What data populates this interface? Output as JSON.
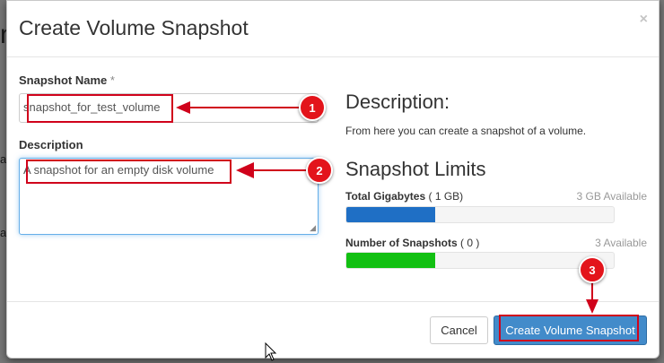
{
  "dialog": {
    "title": "Create Volume Snapshot",
    "close_glyph": "×"
  },
  "form": {
    "snapshot_name_label": "Snapshot Name",
    "required_mark": "*",
    "snapshot_name_value": "snapshot_for_test_volume",
    "description_label": "Description",
    "description_value": "A snapshot for an empty disk volume"
  },
  "info": {
    "heading": "Description:",
    "text": "From here you can create a snapshot of a volume."
  },
  "limits": {
    "heading": "Snapshot Limits",
    "gigabytes": {
      "label": "Total Gigabytes",
      "detail": "( 1 GB)",
      "available": "3 GB Available",
      "fill_fraction": 0.333,
      "color": "#1f6fc5"
    },
    "snapshots": {
      "label": "Number of Snapshots",
      "detail": "( 0 )",
      "available": "3 Available",
      "fill_fraction": 0.333,
      "color": "#12c012"
    }
  },
  "footer": {
    "cancel_label": "Cancel",
    "submit_label": "Create Volume Snapshot"
  },
  "annotations": {
    "badge_1": "1",
    "badge_2": "2",
    "badge_3": "3",
    "color": "#d0021b"
  },
  "background": {
    "text_1": "n",
    "text_2": "a",
    "text_3": "a"
  }
}
